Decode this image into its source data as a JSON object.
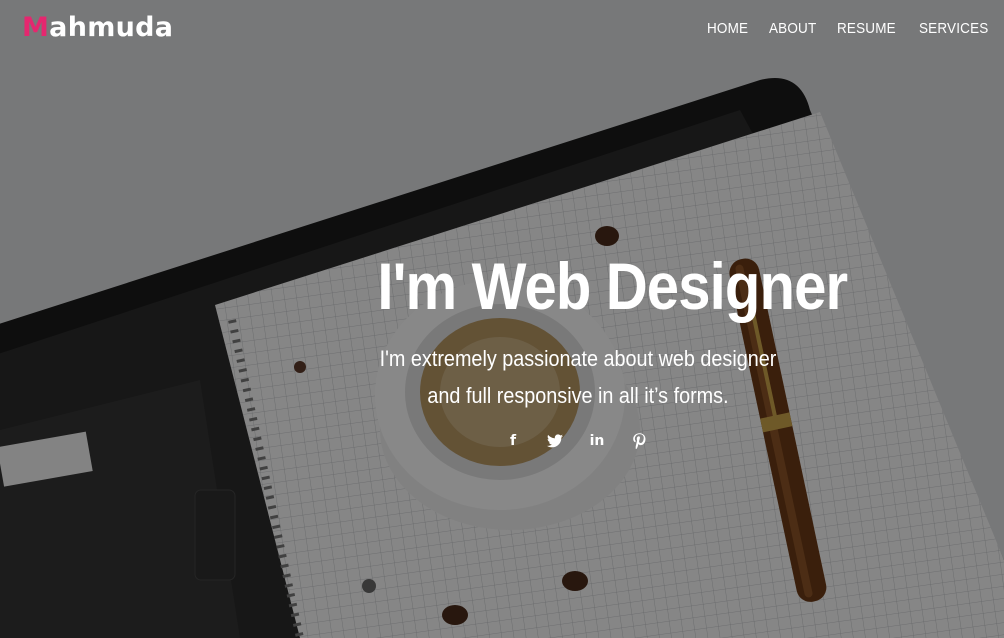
{
  "logo": {
    "first_letter": "M",
    "rest": "ahmuda"
  },
  "nav": {
    "items": [
      {
        "label": "HOME"
      },
      {
        "label": "ABOUT"
      },
      {
        "label": "RESUME"
      },
      {
        "label": "SERVICES"
      }
    ]
  },
  "hero": {
    "title": "I'm Web Designer",
    "tagline_line1": "I'm extremely passionate about web designer",
    "tagline_line2": "and full responsive in all it’s forms."
  },
  "social": {
    "facebook": "f",
    "twitter_icon": "twitter-icon",
    "linkedin": "in",
    "pinterest_icon": "pinterest-icon"
  },
  "colors": {
    "accent": "#e5276f",
    "text": "#ffffff"
  }
}
